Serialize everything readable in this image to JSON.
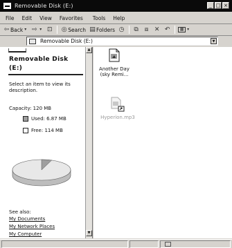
{
  "window": {
    "title": "Removable Disk (E:)"
  },
  "menu": [
    "File",
    "Edit",
    "View",
    "Favorites",
    "Tools",
    "Help"
  ],
  "toolbar": {
    "back_label": "Back",
    "search_label": "Search",
    "folders_label": "Folders"
  },
  "address": {
    "value": "Removable Disk (E:)"
  },
  "left_panel": {
    "title_line1": "Removable Disk",
    "title_line2": "(E:)",
    "select_text": "Select an item to view its description.",
    "capacity_label": "Capacity: 120 MB",
    "used_label": "Used: 6.87 MB",
    "free_label": "Free: 114 MB",
    "used_mb": 6.87,
    "free_mb": 114,
    "see_also": "See also:",
    "links": [
      "My Documents",
      "My Network Places",
      "My Computer"
    ]
  },
  "files": [
    {
      "name_line1": "Another Day",
      "name_line2": "(sky Remi...",
      "icon": "media-file-icon"
    },
    {
      "name_line1": "Hyperion.mp3",
      "name_line2": "",
      "icon": "mp3-shortcut-icon"
    }
  ],
  "colors": {
    "titlebar": "#0a0a0a",
    "chrome": "#d6d3ce",
    "pane": "#ffffff",
    "used_swatch": "#9e9e9e",
    "free_swatch": "#ffffff"
  }
}
